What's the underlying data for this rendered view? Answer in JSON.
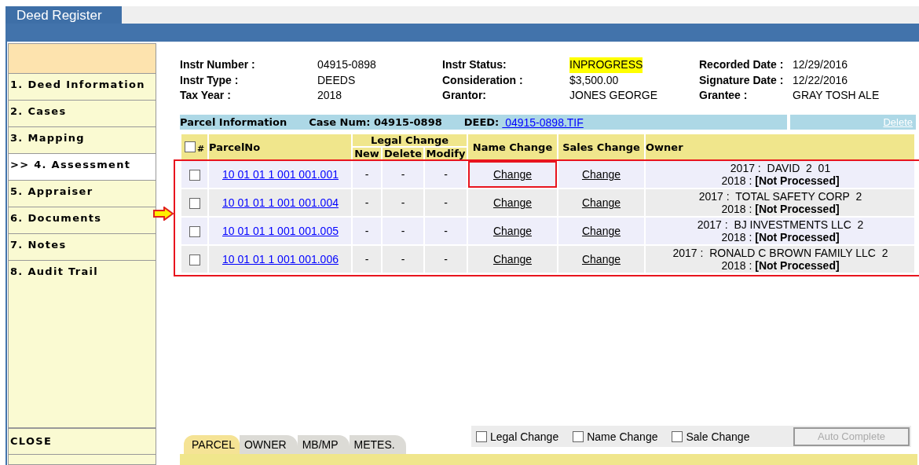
{
  "window": {
    "title": "Deed Register"
  },
  "sidebar": {
    "items": [
      {
        "label": "1. Deed Information",
        "selected": false
      },
      {
        "label": "2. Cases",
        "selected": false
      },
      {
        "label": "3. Mapping",
        "selected": false
      },
      {
        "label": ">> 4. Assessment",
        "selected": true
      },
      {
        "label": "5. Appraiser",
        "selected": false
      },
      {
        "label": "6. Documents",
        "selected": false
      },
      {
        "label": "7. Notes",
        "selected": false
      },
      {
        "label": "8. Audit Trail",
        "selected": false
      }
    ],
    "close": "CLOSE"
  },
  "summary": [
    [
      {
        "label": "Instr Number :",
        "value": "04915-0898"
      },
      {
        "label": "Instr Type :",
        "value": "DEEDS"
      },
      {
        "label": "Tax Year :",
        "value": "2018"
      }
    ],
    [
      {
        "label": "Instr Status:",
        "value": "INPROGRESS",
        "highlighted": true
      },
      {
        "label": "Consideration :",
        "value": "$3,500.00"
      },
      {
        "label": "Grantor:",
        "value": "JONES GEORGE"
      }
    ],
    [
      {
        "label": "Recorded Date :",
        "value": "12/29/2016"
      },
      {
        "label": "Signature Date :",
        "value": "12/22/2016"
      },
      {
        "label": "Grantee :",
        "value": "GRAY TOSH ALE"
      }
    ]
  ],
  "parcel_bar": {
    "title": "Parcel Information",
    "case_label": "Case Num: 04915-0898",
    "deed_label": "DEED:",
    "deed_link": " 04915-0898.TIF",
    "delete": "Delete"
  },
  "table": {
    "all_checked": false,
    "columns": {
      "hash": "#",
      "parcel": "ParcelNo",
      "legal": "Legal Change",
      "new": "New",
      "delete": "Delete",
      "modify": "Modify",
      "name": "Name Change",
      "sales": "Sales Change",
      "owner": "Owner"
    },
    "rows": [
      {
        "checked": false,
        "parcel": "10 01 01 1 001 001.001",
        "new": "-",
        "delete": "-",
        "modify": "-",
        "name": "Change",
        "sales": "Change",
        "owner": [
          "2017 :  DAVID  2  01",
          "2018 : **[Not Processed]**"
        ],
        "name_highlighted": true,
        "arrow": false
      },
      {
        "checked": false,
        "parcel": "10 01 01 1 001 001.004",
        "new": "-",
        "delete": "-",
        "modify": "-",
        "name": "Change",
        "sales": "Change",
        "owner": [
          "2017 :  TOTAL SAFETY CORP  2",
          "2018 : **[Not Processed]**"
        ],
        "name_highlighted": false,
        "arrow": true
      },
      {
        "checked": false,
        "parcel": "10 01 01 1 001 001.005",
        "new": "-",
        "delete": "-",
        "modify": "-",
        "name": "Change",
        "sales": "Change",
        "owner": [
          "2017 :  BJ INVESTMENTS LLC  2",
          "2018 : **[Not Processed]**"
        ],
        "name_highlighted": false,
        "arrow": false
      },
      {
        "checked": false,
        "parcel": "10 01 01 1 001 001.006",
        "new": "-",
        "delete": "-",
        "modify": "-",
        "name": "Change",
        "sales": "Change",
        "owner": [
          "2017 :  RONALD C BROWN FAMILY LLC  2",
          "2018 : **[Not Processed]**"
        ],
        "name_highlighted": false,
        "arrow": false
      }
    ]
  },
  "bottom_tabs": [
    {
      "label": "PARCEL",
      "selected": true
    },
    {
      "label": "OWNER",
      "selected": false
    },
    {
      "label": "MB/MP",
      "selected": false
    },
    {
      "label": "METES.",
      "selected": false
    }
  ],
  "options": [
    {
      "label": "Legal Change",
      "checked": false
    },
    {
      "label": "Name Change",
      "checked": false
    },
    {
      "label": "Sale Change",
      "checked": false
    }
  ],
  "auto_complete": {
    "label": "Auto Complete",
    "disabled": true
  }
}
